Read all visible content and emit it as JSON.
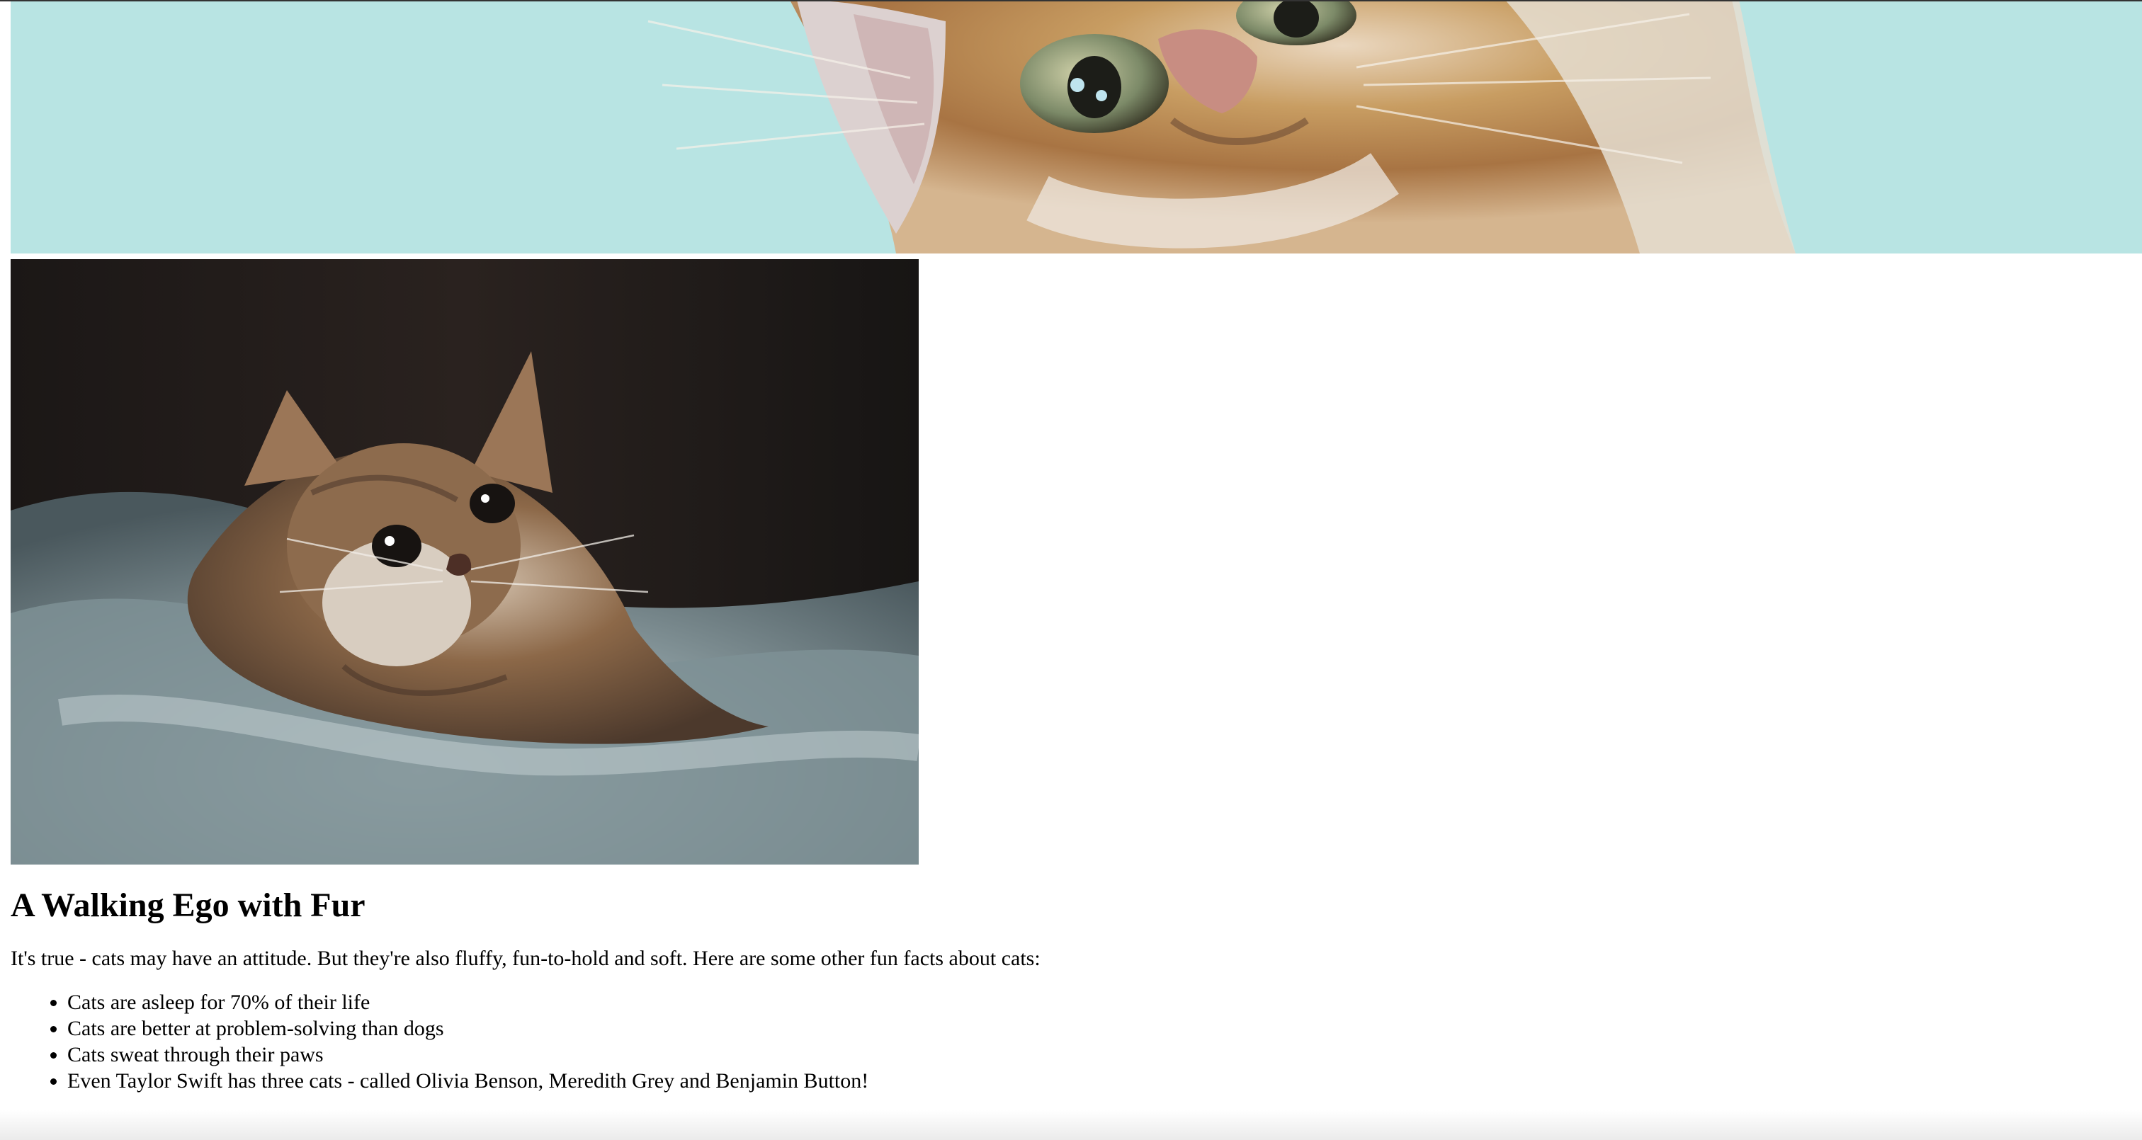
{
  "article": {
    "title": "A Walking Ego with Fur",
    "intro": "It's true - cats may have an attitude. But they're also fluffy, fun-to-hold and soft. Here are some other fun facts about cats:",
    "facts": [
      "Cats are asleep for 70% of their life",
      "Cats are better at problem-solving than dogs",
      "Cats sweat through their paws",
      "Even Taylor Swift has three cats - called Olivia Benson, Meredith Grey and Benjamin Button!"
    ]
  },
  "images": {
    "banner": {
      "icon": "cat-closeup-photo",
      "background_color": "#b8e4e3",
      "fur_color": "#d5b07d"
    },
    "kitten": {
      "icon": "kitten-in-bed-photo",
      "background_color": "#1c1816",
      "blanket_color": "#8f9ea1"
    }
  }
}
